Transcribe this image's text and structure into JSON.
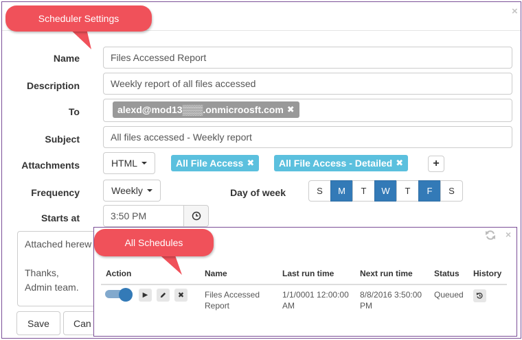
{
  "callouts": {
    "scheduler_settings": "Scheduler Settings",
    "all_schedules": "All Schedules"
  },
  "form": {
    "name_label": "Name",
    "name_value": "Files Accessed Report",
    "description_label": "Description",
    "description_value": "Weekly report of all files accessed",
    "to_label": "To",
    "to_recipient": "alexd@mod13▒▒▒.onmicroosft.com",
    "subject_label": "Subject",
    "subject_value": "All files accessed - Weekly report",
    "attachments_label": "Attachments",
    "attachment_format": "HTML",
    "attachments": [
      "All File Access",
      "All File Access - Detailed"
    ],
    "frequency_label": "Frequency",
    "frequency_value": "Weekly",
    "day_of_week_label": "Day of week",
    "days": [
      {
        "label": "S",
        "active": false
      },
      {
        "label": "M",
        "active": true
      },
      {
        "label": "T",
        "active": false
      },
      {
        "label": "W",
        "active": true
      },
      {
        "label": "T",
        "active": false
      },
      {
        "label": "F",
        "active": true
      },
      {
        "label": "S",
        "active": false
      }
    ],
    "starts_at_label": "Starts at",
    "starts_at_value": "3:50 PM",
    "body_lines": [
      "Attached herew",
      "",
      "Thanks,",
      "Admin team."
    ],
    "save_label": "Save",
    "cancel_label": "Can"
  },
  "schedules": {
    "headers": {
      "action": "Action",
      "name": "Name",
      "last_run": "Last run time",
      "next_run": "Next run time",
      "status": "Status",
      "history": "History"
    },
    "rows": [
      {
        "name_line1": "Files Accessed",
        "name_line2": "Report",
        "last_run_line1": "1/1/0001 12:00:00",
        "last_run_line2": "AM",
        "next_run_line1": "8/8/2016 3:50:00",
        "next_run_line2": "PM",
        "status": "Queued",
        "enabled": true
      }
    ]
  },
  "colors": {
    "accent": "#337ab7",
    "tag_blue": "#5bc0de",
    "callout": "#f0515a",
    "border": "#7a4d96"
  }
}
